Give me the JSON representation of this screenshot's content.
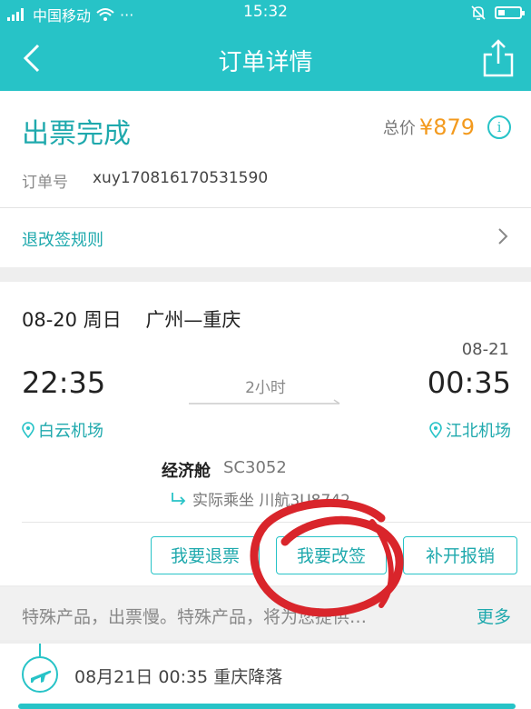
{
  "status_bar": {
    "carrier": "中国移动",
    "dots": "···",
    "time": "15:32",
    "battery_fraction": 0.3
  },
  "nav": {
    "title": "订单详情",
    "back_icon": "chevron-left-icon",
    "share_icon": "share-icon"
  },
  "order": {
    "status": "出票完成",
    "price_label": "总价",
    "price": "¥879",
    "info_icon_text": "i",
    "order_no_label": "订单号",
    "order_no": "xuy170816170531590",
    "rules_link": "退改签规则"
  },
  "flight": {
    "date_route": "08-20 周日    广州—重庆",
    "arrival_date": "08-21",
    "dep_time": "22:35",
    "arr_time": "00:35",
    "duration": "2小时",
    "dep_airport": "白云机场",
    "arr_airport": "江北机场",
    "cabin": "经济舱",
    "flight_no": "SC3052",
    "actual_label": "实际乘坐 川航3U8742"
  },
  "actions": {
    "refund": "我要退票",
    "change": "我要改签",
    "invoice": "补开报销"
  },
  "notice": {
    "text": "特殊产品，出票慢。特殊产品，将为您提供…",
    "more": "更多"
  },
  "timeline": {
    "landing": "08月21日 00:35 重庆降落"
  },
  "colors": {
    "accent": "#27c3c7",
    "price": "#f39a1e",
    "annotation": "#d9252b"
  }
}
